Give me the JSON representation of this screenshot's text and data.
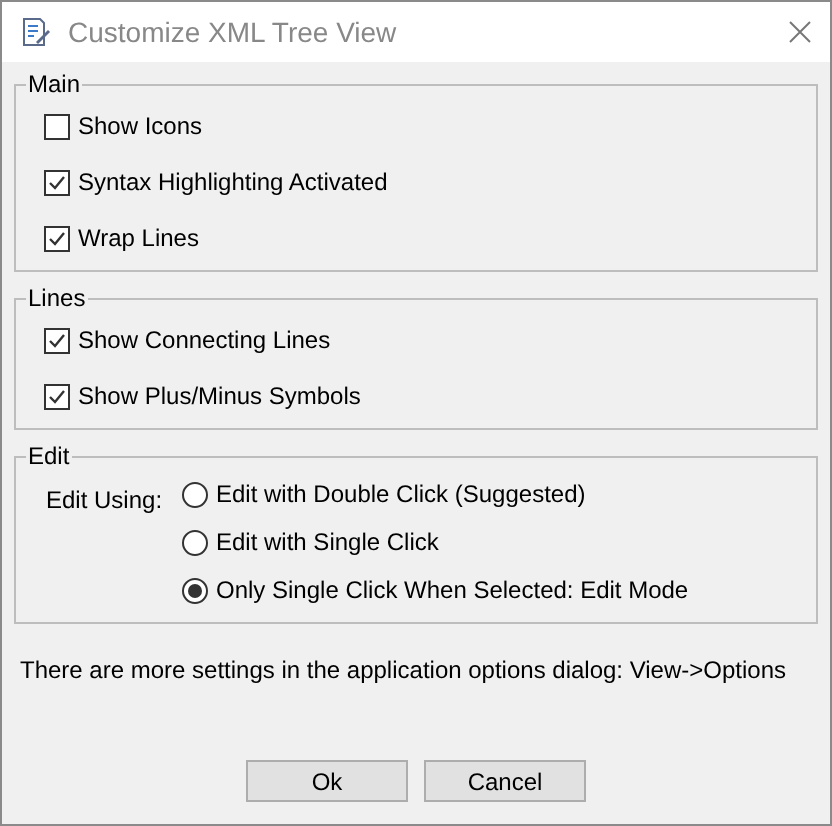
{
  "window": {
    "title": "Customize XML Tree View"
  },
  "groups": [
    {
      "title": "Main",
      "kind": "checkboxes",
      "items": [
        {
          "label": "Show Icons",
          "checked": false
        },
        {
          "label": "Syntax Highlighting Activated",
          "checked": true
        },
        {
          "label": "Wrap Lines",
          "checked": true
        }
      ]
    },
    {
      "title": "Lines",
      "kind": "checkboxes",
      "items": [
        {
          "label": "Show Connecting Lines",
          "checked": true
        },
        {
          "label": "Show Plus/Minus Symbols",
          "checked": true
        }
      ]
    },
    {
      "title": "Edit",
      "kind": "radios",
      "label": "Edit Using:",
      "items": [
        {
          "label": "Edit with Double Click (Suggested)",
          "selected": false
        },
        {
          "label": "Edit with Single Click",
          "selected": false
        },
        {
          "label": "Only Single Click When Selected: Edit Mode",
          "selected": true
        }
      ]
    }
  ],
  "note": "There are more settings in the application options dialog: View->Options",
  "buttons": [
    "Ok",
    "Cancel"
  ]
}
